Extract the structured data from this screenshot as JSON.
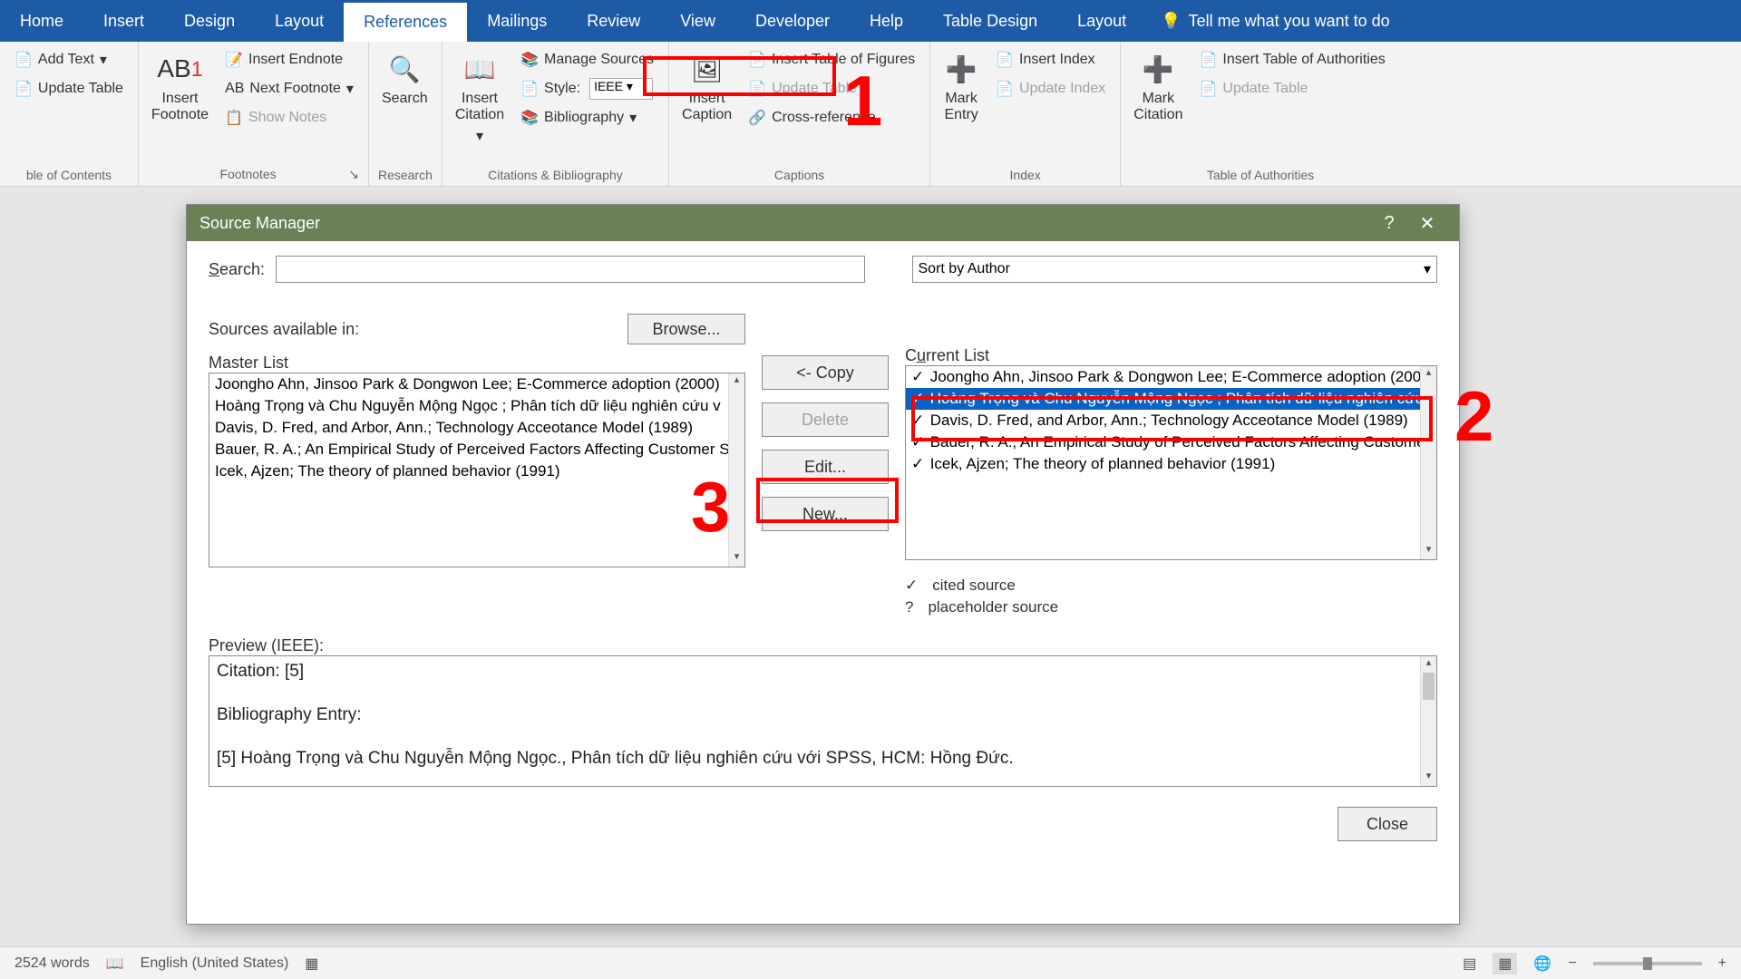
{
  "ribbonTabs": [
    "Home",
    "Insert",
    "Design",
    "Layout",
    "References",
    "Mailings",
    "Review",
    "View",
    "Developer",
    "Help",
    "Table Design",
    "Layout"
  ],
  "activeTab": "References",
  "tellMe": "Tell me what you want to do",
  "groups": {
    "toc": {
      "addText": "Add Text",
      "updateTable": "Update Table",
      "label": "ble of Contents"
    },
    "footnotes": {
      "insertFootnote": "Insert\nFootnote",
      "insertEndnote": "Insert Endnote",
      "nextFootnote": "Next Footnote",
      "showNotes": "Show Notes",
      "label": "Footnotes"
    },
    "research": {
      "search": "Search",
      "label": "Research"
    },
    "citations": {
      "insertCitation": "Insert\nCitation",
      "manageSources": "Manage Sources",
      "styleLabel": "Style:",
      "styleValue": "IEEE",
      "bibliography": "Bibliography",
      "label": "Citations & Bibliography"
    },
    "captions": {
      "insertCaption": "Insert\nCaption",
      "insertTof": "Insert Table of Figures",
      "updateTable": "Update Table",
      "crossRef": "Cross-reference",
      "label": "Captions"
    },
    "index": {
      "markEntry": "Mark\nEntry",
      "insertIndex": "Insert Index",
      "updateIndex": "Update Index",
      "label": "Index"
    },
    "toa": {
      "markCitation": "Mark\nCitation",
      "insertToa": "Insert Table of Authorities",
      "updateTable": "Update Table",
      "label": "Table of Authorities"
    }
  },
  "dialog": {
    "title": "Source Manager",
    "searchLabel": "Search:",
    "sortLabel": "Sort by Author",
    "sourcesAvail": "Sources available in:",
    "browse": "Browse...",
    "masterList": "Master List",
    "currentList": "Current List",
    "copy": "<- Copy",
    "delete": "Delete",
    "edit": "Edit...",
    "new": "New...",
    "citedLegend": "cited source",
    "placeholderLegend": "placeholder source",
    "previewLabel": "Preview (IEEE):",
    "close": "Close",
    "masterItems": [
      "Joongho Ahn, Jinsoo Park & Dongwon Lee; E-Commerce adoption (2000)",
      "Hoàng Trọng và Chu Nguyễn Mộng Ngọc ; Phân tích dữ liệu nghiên cứu v",
      "Davis, D. Fred, and Arbor, Ann.; Technology Acceotance Model (1989)",
      "Bauer, R. A.; An Empirical Study of Perceived Factors Affecting Customer S",
      "Icek, Ajzen; The theory of planned behavior (1991)"
    ],
    "currentItems": [
      {
        "t": "Joongho Ahn, Jinsoo Park & Dongwon Lee; E-Commerce adoption (200",
        "sel": false
      },
      {
        "t": "Hoàng Trọng và Chu Nguyễn Mộng Ngọc ; Phân tích dữ liệu nghiên cứu",
        "sel": true
      },
      {
        "t": "Davis, D. Fred, and Arbor, Ann.; Technology Acceotance Model (1989)",
        "sel": false
      },
      {
        "t": "Bauer, R. A.; An Empirical Study of Perceived Factors Affecting Customer",
        "sel": false
      },
      {
        "t": "Icek, Ajzen; The theory of planned behavior (1991)",
        "sel": false
      }
    ],
    "preview": {
      "citation": "Citation:  [5]",
      "bibLabel": "Bibliography Entry:",
      "bibEntry": "[5] Hoàng Trọng và Chu Nguyễn Mộng Ngọc., Phân tích dữ liệu nghiên cứu với SPSS, HCM: Hồng Đức."
    }
  },
  "status": {
    "words": "2524 words",
    "lang": "English (United States)"
  },
  "annotations": {
    "n1": "1",
    "n2": "2",
    "n3": "3"
  }
}
